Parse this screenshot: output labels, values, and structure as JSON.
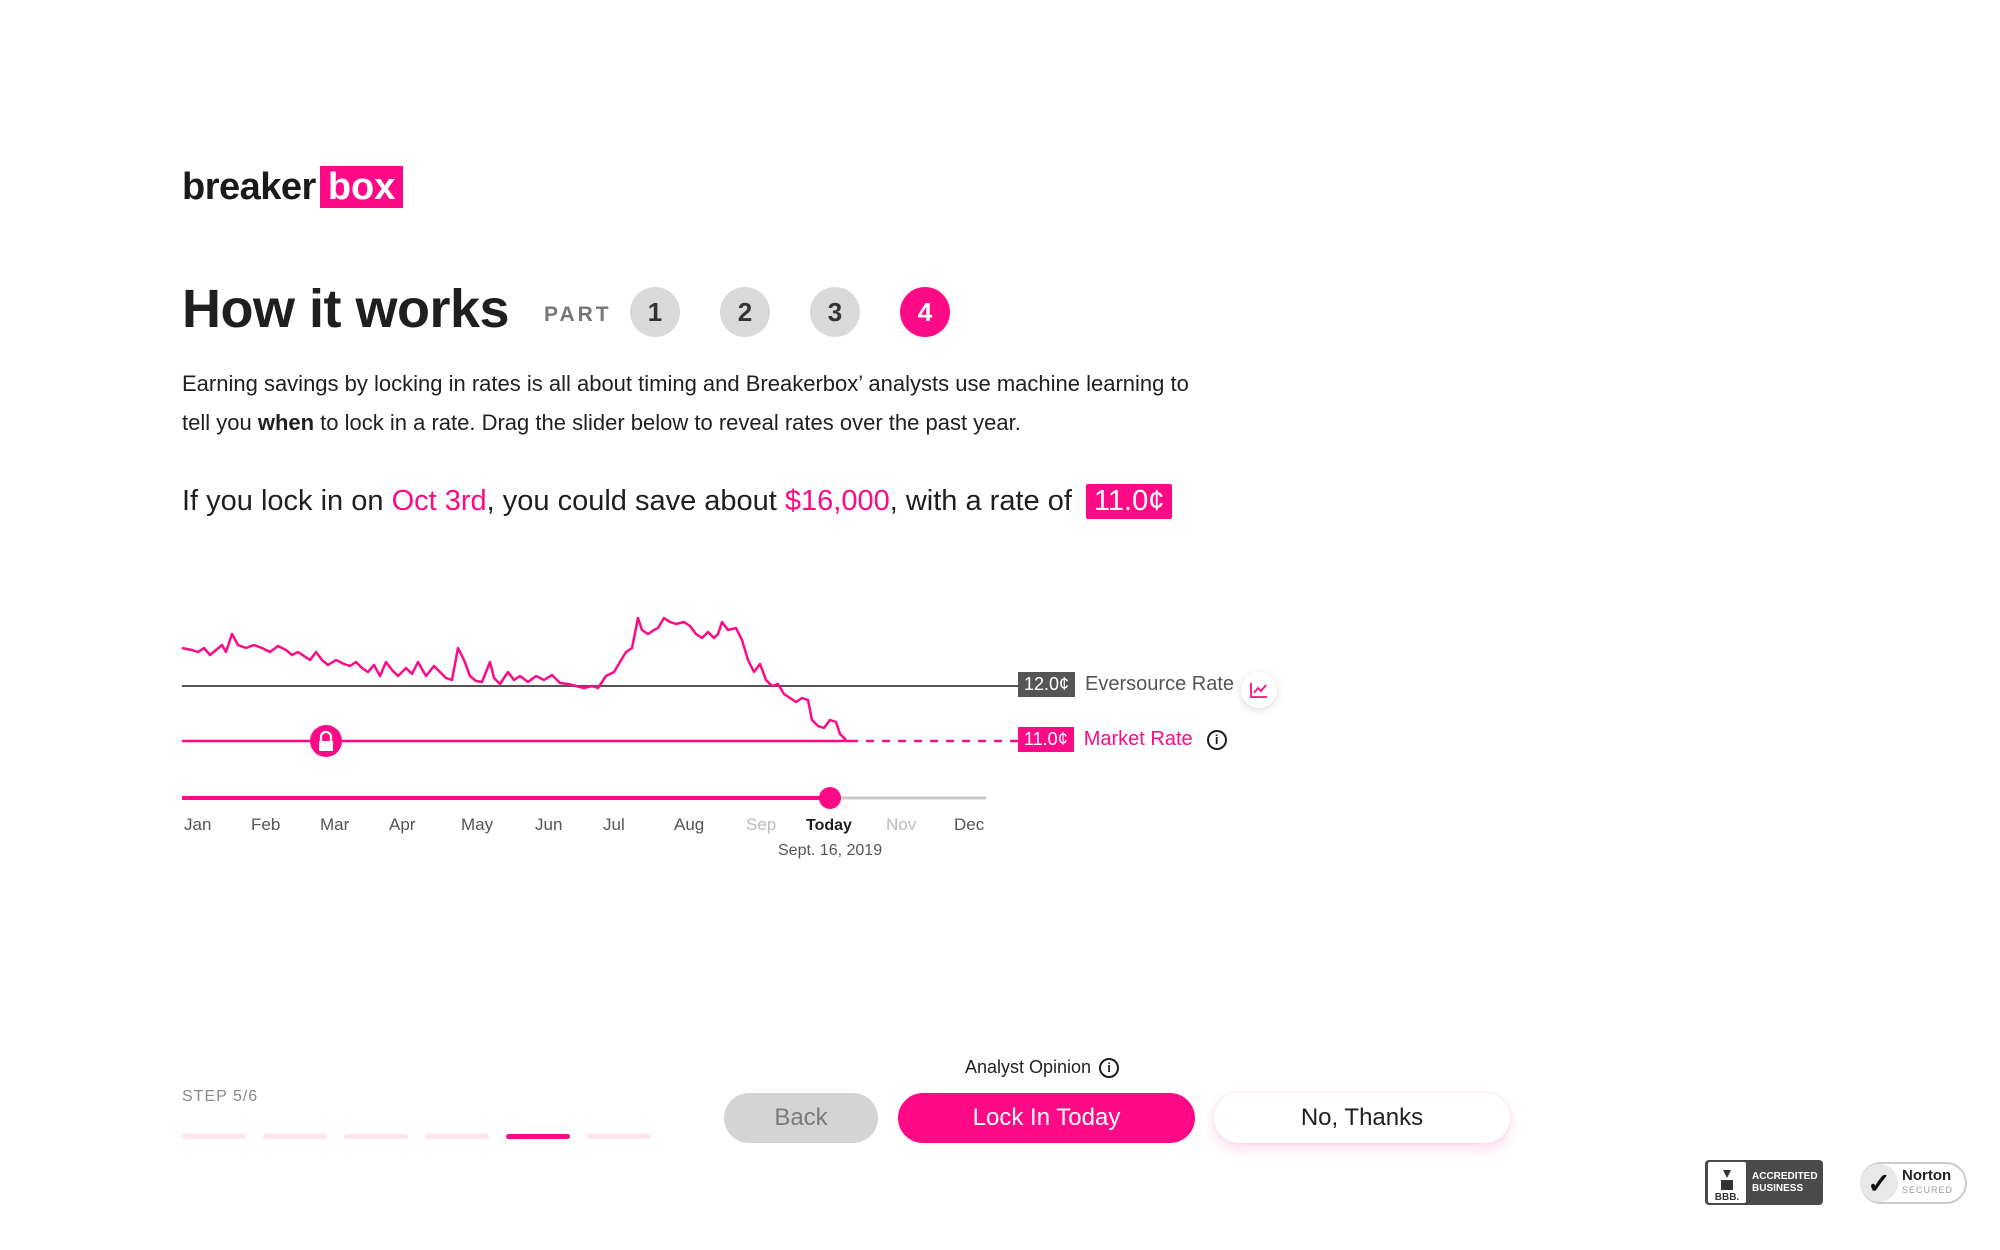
{
  "brand": {
    "logo_left": "breaker",
    "logo_right": "box",
    "accent": "#ff0a86"
  },
  "header": {
    "title": "How it works",
    "part_label": "PART",
    "parts": [
      "1",
      "2",
      "3",
      "4"
    ],
    "active_part": 4
  },
  "description": {
    "line1": "Earning savings by locking in rates is all about timing and Breakerbox’ analysts use machine learning to",
    "line2_prefix": "tell you ",
    "line2_bold": "when",
    "line2_suffix": " to lock in a rate. Drag the slider below to reveal rates over the past year."
  },
  "lock_sentence": {
    "prefix": "If you lock in on ",
    "date": "Oct 3rd",
    "middle": ", you could save about ",
    "savings": "$16,000",
    "suffix": ", with a rate of",
    "rate": "11.0¢"
  },
  "chart_data": {
    "type": "line",
    "series": [
      {
        "name": "Market Rate",
        "color": "#ff0a86"
      }
    ],
    "reference_lines": [
      {
        "name": "Eversource Rate",
        "value_label": "12.0¢",
        "color": "#555555"
      },
      {
        "name": "Market Rate",
        "value_label": "11.0¢",
        "color": "#ff0a86"
      }
    ],
    "months": [
      "Jan",
      "Feb",
      "Mar",
      "Apr",
      "May",
      "Jun",
      "Jul",
      "Aug",
      "Sep",
      "Today",
      "Nov",
      "Dec"
    ],
    "today_label": "Today",
    "today_date": "Sept. 16, 2019"
  },
  "footer": {
    "analyst_label": "Analyst Opinion",
    "back": "Back",
    "lock": "Lock In Today",
    "no_thanks": "No, Thanks",
    "step": "STEP 5/6",
    "step_count": 6,
    "step_active": 5
  },
  "badges": {
    "bbb_line1": "ACCREDITED",
    "bbb_line2": "BUSINESS",
    "bbb_logo": "BBB.",
    "norton_name": "Norton",
    "norton_sub": "SECURED"
  }
}
